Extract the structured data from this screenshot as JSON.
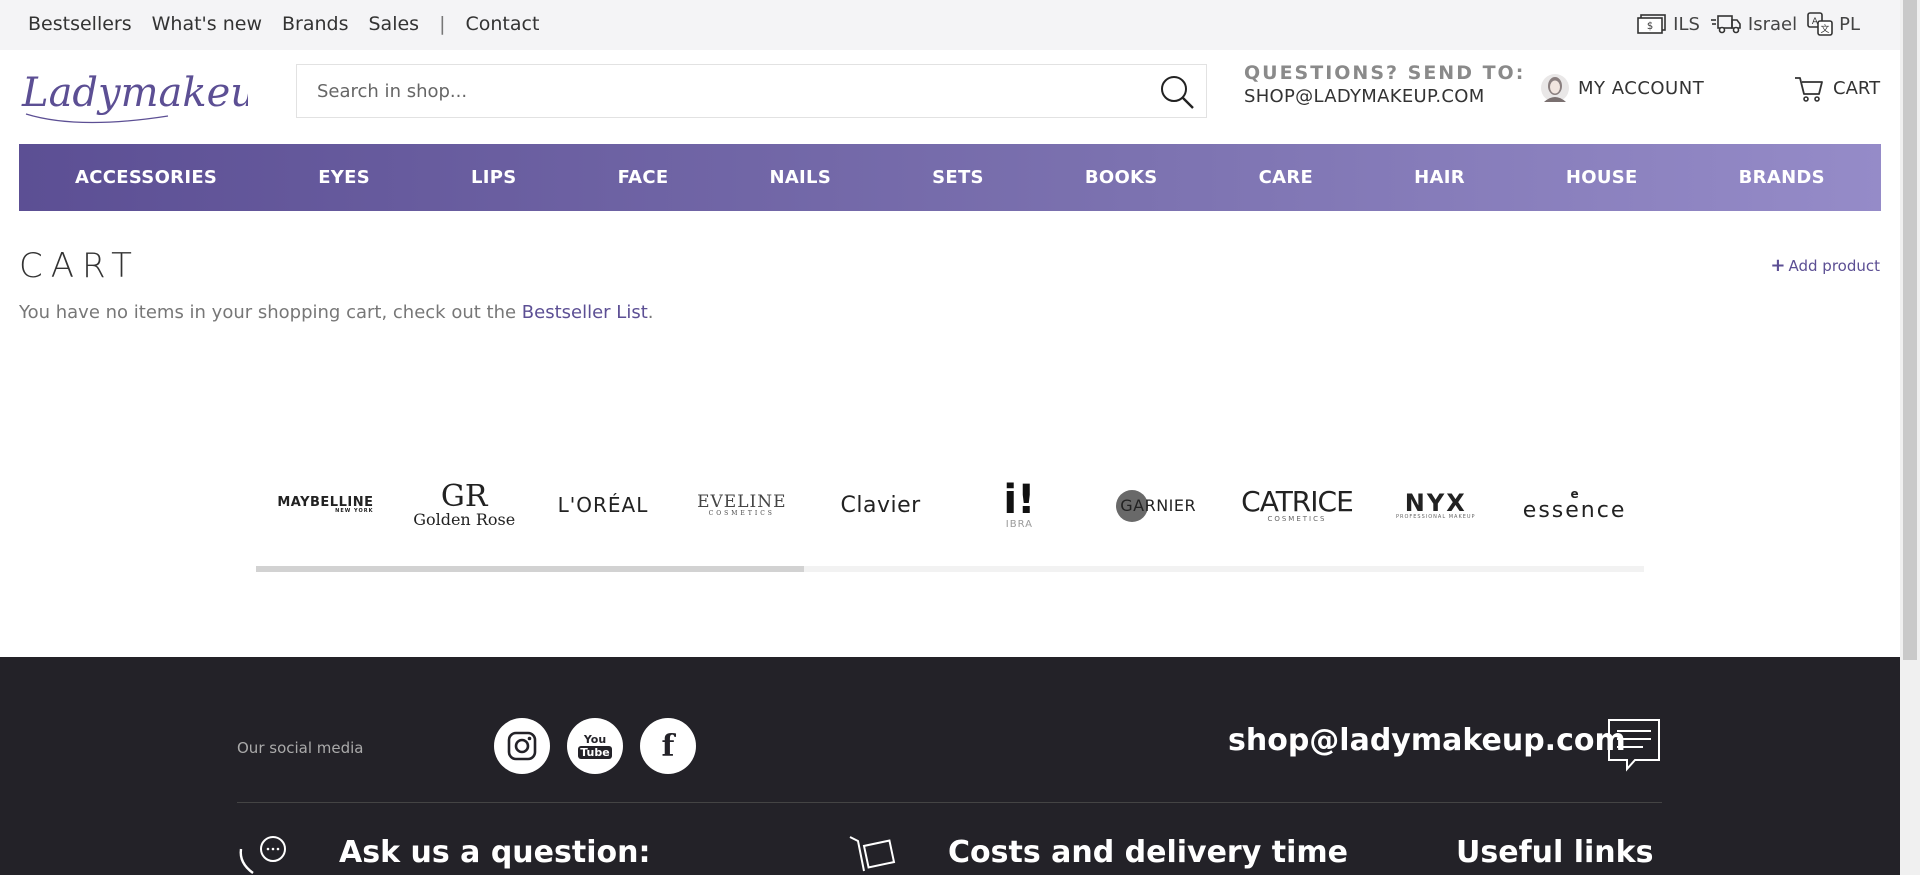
{
  "topbar": {
    "links": [
      "Bestsellers",
      "What's new",
      "Brands",
      "Sales",
      "Contact"
    ],
    "separator": "|",
    "currency": "ILS",
    "country": "Israel",
    "language": "PL"
  },
  "header": {
    "logo_text": "Ladymakeup",
    "search_placeholder": "Search in shop...",
    "questions_label": "QUESTIONS? SEND TO:",
    "questions_email": "SHOP@LADYMAKEUP.COM",
    "account_label": "MY ACCOUNT",
    "cart_label": "CART"
  },
  "categories": [
    "ACCESSORIES",
    "EYES",
    "LIPS",
    "FACE",
    "NAILS",
    "SETS",
    "BOOKS",
    "CARE",
    "HAIR",
    "HOUSE",
    "BRANDS"
  ],
  "cart": {
    "title": "CART",
    "add_product_label": "Add product",
    "empty_message": "You have no items in your shopping cart, check out the ",
    "empty_link": "Bestseller List",
    "empty_suffix": "."
  },
  "brands": {
    "maybelline": "MAYBELLINE",
    "maybelline_sub": "NEW YORK",
    "golden_rose_mark": "GR",
    "golden_rose": "Golden Rose",
    "loreal": "L'ORÉAL",
    "eveline": "EVELINE",
    "eveline_sub": "COSMETICS",
    "clavier": "Clavier",
    "ibra_mark": "i!",
    "ibra": "IBRA",
    "garnier": "GARNIER",
    "catrice": "CATRICE",
    "catrice_sub": "COSMETICS",
    "nyx": "NYX",
    "nyx_sub": "PROFESSIONAL MAKEUP",
    "essence_mark": "e",
    "essence": "essence",
    "scroll_progress": 0.395
  },
  "footer": {
    "social_label": "Our social media",
    "youtube_you": "You",
    "youtube_tube": "Tube",
    "facebook": "f",
    "email": "shop@ladymakeup.com",
    "col1": "Ask us a question:",
    "col2": "Costs and delivery time",
    "col3": "Useful links"
  }
}
